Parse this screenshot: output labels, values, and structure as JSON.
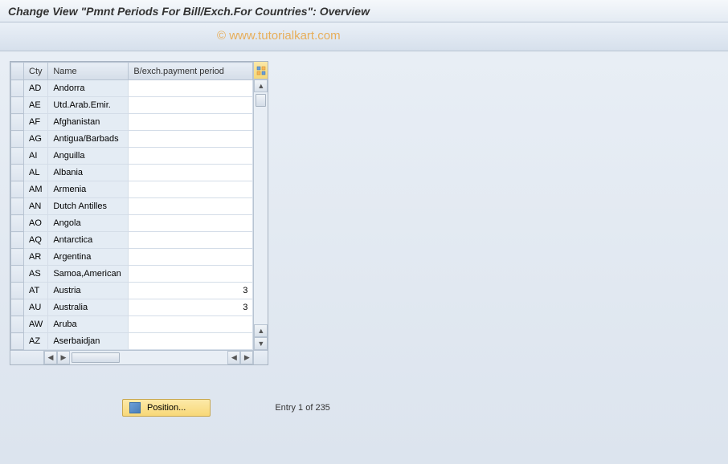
{
  "title": "Change View \"Pmnt Periods For Bill/Exch.For Countries\": Overview",
  "watermark": "© www.tutorialkart.com",
  "columns": {
    "cty": "Cty",
    "name": "Name",
    "period": "B/exch.payment period"
  },
  "rows": [
    {
      "code": "AD",
      "name": "Andorra",
      "period": ""
    },
    {
      "code": "AE",
      "name": "Utd.Arab.Emir.",
      "period": ""
    },
    {
      "code": "AF",
      "name": "Afghanistan",
      "period": ""
    },
    {
      "code": "AG",
      "name": "Antigua/Barbads",
      "period": ""
    },
    {
      "code": "AI",
      "name": "Anguilla",
      "period": ""
    },
    {
      "code": "AL",
      "name": "Albania",
      "period": ""
    },
    {
      "code": "AM",
      "name": "Armenia",
      "period": ""
    },
    {
      "code": "AN",
      "name": "Dutch Antilles",
      "period": ""
    },
    {
      "code": "AO",
      "name": "Angola",
      "period": ""
    },
    {
      "code": "AQ",
      "name": "Antarctica",
      "period": ""
    },
    {
      "code": "AR",
      "name": "Argentina",
      "period": ""
    },
    {
      "code": "AS",
      "name": "Samoa,American",
      "period": ""
    },
    {
      "code": "AT",
      "name": "Austria",
      "period": "3"
    },
    {
      "code": "AU",
      "name": "Australia",
      "period": "3"
    },
    {
      "code": "AW",
      "name": "Aruba",
      "period": ""
    },
    {
      "code": "AZ",
      "name": "Aserbaidjan",
      "period": ""
    }
  ],
  "position_btn": "Position...",
  "entry_text": "Entry 1 of 235"
}
